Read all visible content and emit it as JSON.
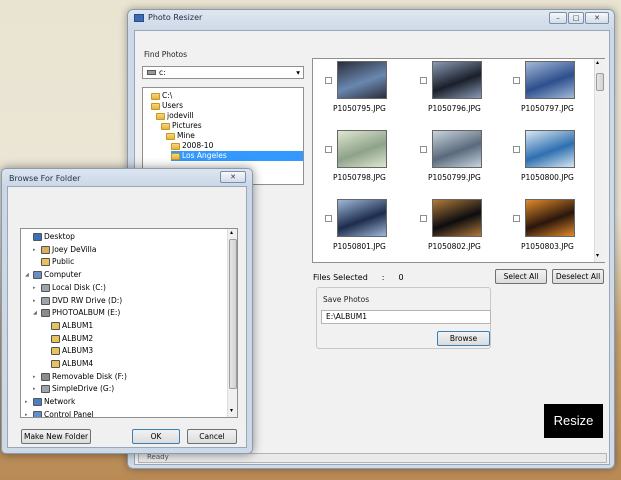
{
  "main_window": {
    "title": "Photo Resizer",
    "controls": [
      "–",
      "□",
      "✕"
    ],
    "find_photos_label": "Find Photos",
    "drive_combo_value": "c:",
    "tree": [
      "C:\\",
      "Users",
      "jodevill",
      "Pictures",
      "Mine",
      "2008-10",
      "Los Angeles"
    ],
    "photos": [
      {
        "name": "P1050795.JPG",
        "colors": [
          "#6a87b0",
          "#2b2f3a"
        ]
      },
      {
        "name": "P1050796.JPG",
        "colors": [
          "#1a1f2a",
          "#8a9bb5"
        ]
      },
      {
        "name": "P1050797.JPG",
        "colors": [
          "#2d4f8c",
          "#a3b9d8"
        ]
      },
      {
        "name": "P1050798.JPG",
        "colors": [
          "#8ea28a",
          "#dfe7d0"
        ]
      },
      {
        "name": "P1050799.JPG",
        "colors": [
          "#5a6a7c",
          "#c9d4de"
        ]
      },
      {
        "name": "P1050800.JPG",
        "colors": [
          "#2e6fb0",
          "#d7e6f3"
        ]
      },
      {
        "name": "P1050801.JPG",
        "colors": [
          "#1d2c4c",
          "#9fb8d8"
        ]
      },
      {
        "name": "P1050802.JPG",
        "colors": [
          "#0c0c10",
          "#b07a3a"
        ]
      },
      {
        "name": "P1050803.JPG",
        "colors": [
          "#2a160c",
          "#e08a2a"
        ]
      }
    ],
    "files_selected_label": "Files Selected",
    "files_selected_sep": ":",
    "files_selected_count": "0",
    "select_all": "Select All",
    "deselect_all": "Deselect All",
    "save_photos_label": "Save Photos",
    "save_path": "E:\\ALBUM1",
    "browse": "Browse",
    "resize": "Resize",
    "status_label": "Ready"
  },
  "dialog": {
    "title": "Browse For Folder",
    "close": "✕",
    "tree": [
      {
        "label": "Desktop",
        "icon": "desktop-icon",
        "color": "#3a6fc0"
      },
      {
        "label": "Joey DeVilla",
        "icon": "user-folder-icon",
        "color": "#d9b15a"
      },
      {
        "label": "Public",
        "icon": "folder-icon",
        "color": "#e8c25c"
      },
      {
        "label": "Computer",
        "icon": "computer-icon",
        "color": "#6b8fc4"
      },
      {
        "label": "Local Disk (C:)",
        "icon": "disk-icon",
        "color": "#9ea4ab"
      },
      {
        "label": "DVD RW Drive (D:)",
        "icon": "dvd-icon",
        "color": "#9ea4ab"
      },
      {
        "label": "PHOTOALBUM (E:)",
        "icon": "drive-icon",
        "color": "#8c8c8c"
      },
      {
        "label": "ALBUM1",
        "icon": "folder-icon",
        "color": "#e8c25c"
      },
      {
        "label": "ALBUM2",
        "icon": "folder-icon",
        "color": "#e8c25c"
      },
      {
        "label": "ALBUM3",
        "icon": "folder-icon",
        "color": "#e8c25c"
      },
      {
        "label": "ALBUM4",
        "icon": "folder-icon",
        "color": "#e8c25c"
      },
      {
        "label": "Removable Disk (F:)",
        "icon": "drive-icon",
        "color": "#8c8c8c"
      },
      {
        "label": "SimpleDrive (G:)",
        "icon": "drive-icon",
        "color": "#9ea4ab"
      },
      {
        "label": "Network",
        "icon": "network-icon",
        "color": "#4b7cc4"
      },
      {
        "label": "Control Panel",
        "icon": "control-panel-icon",
        "color": "#5f8fd0"
      }
    ],
    "make_new_folder": "Make New Folder",
    "ok": "OK",
    "cancel": "Cancel"
  }
}
